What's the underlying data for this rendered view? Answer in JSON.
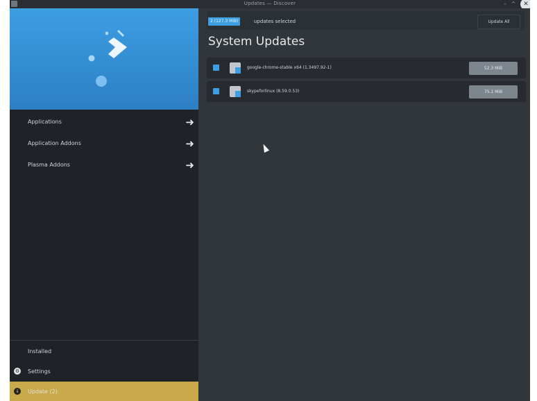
{
  "window": {
    "title": "Updates — Discover"
  },
  "sidebar": {
    "items": [
      {
        "label": "Applications"
      },
      {
        "label": "Application Addons"
      },
      {
        "label": "Plasma Addons"
      }
    ],
    "bottom": [
      {
        "label": "Installed"
      },
      {
        "label": "Settings"
      },
      {
        "label": "Update (2)"
      }
    ]
  },
  "main": {
    "selected_badge": "2 (127.3 MiB)",
    "selected_text": "updates selected",
    "update_all_label": "Update All",
    "section_title": "System Updates",
    "updates": [
      {
        "name": "google-chrome-stable x64 (1.3497.92-1)",
        "size": "52.3 MiB",
        "checked": true
      },
      {
        "name": "skypeforlinux (8.59.0.53)",
        "size": "75.1 MiB",
        "checked": true
      }
    ]
  },
  "colors": {
    "accent": "#3d9ee2",
    "active_item": "#c9a94a",
    "window_bg": "#31363b",
    "sidebar_bg": "#1f2327"
  }
}
